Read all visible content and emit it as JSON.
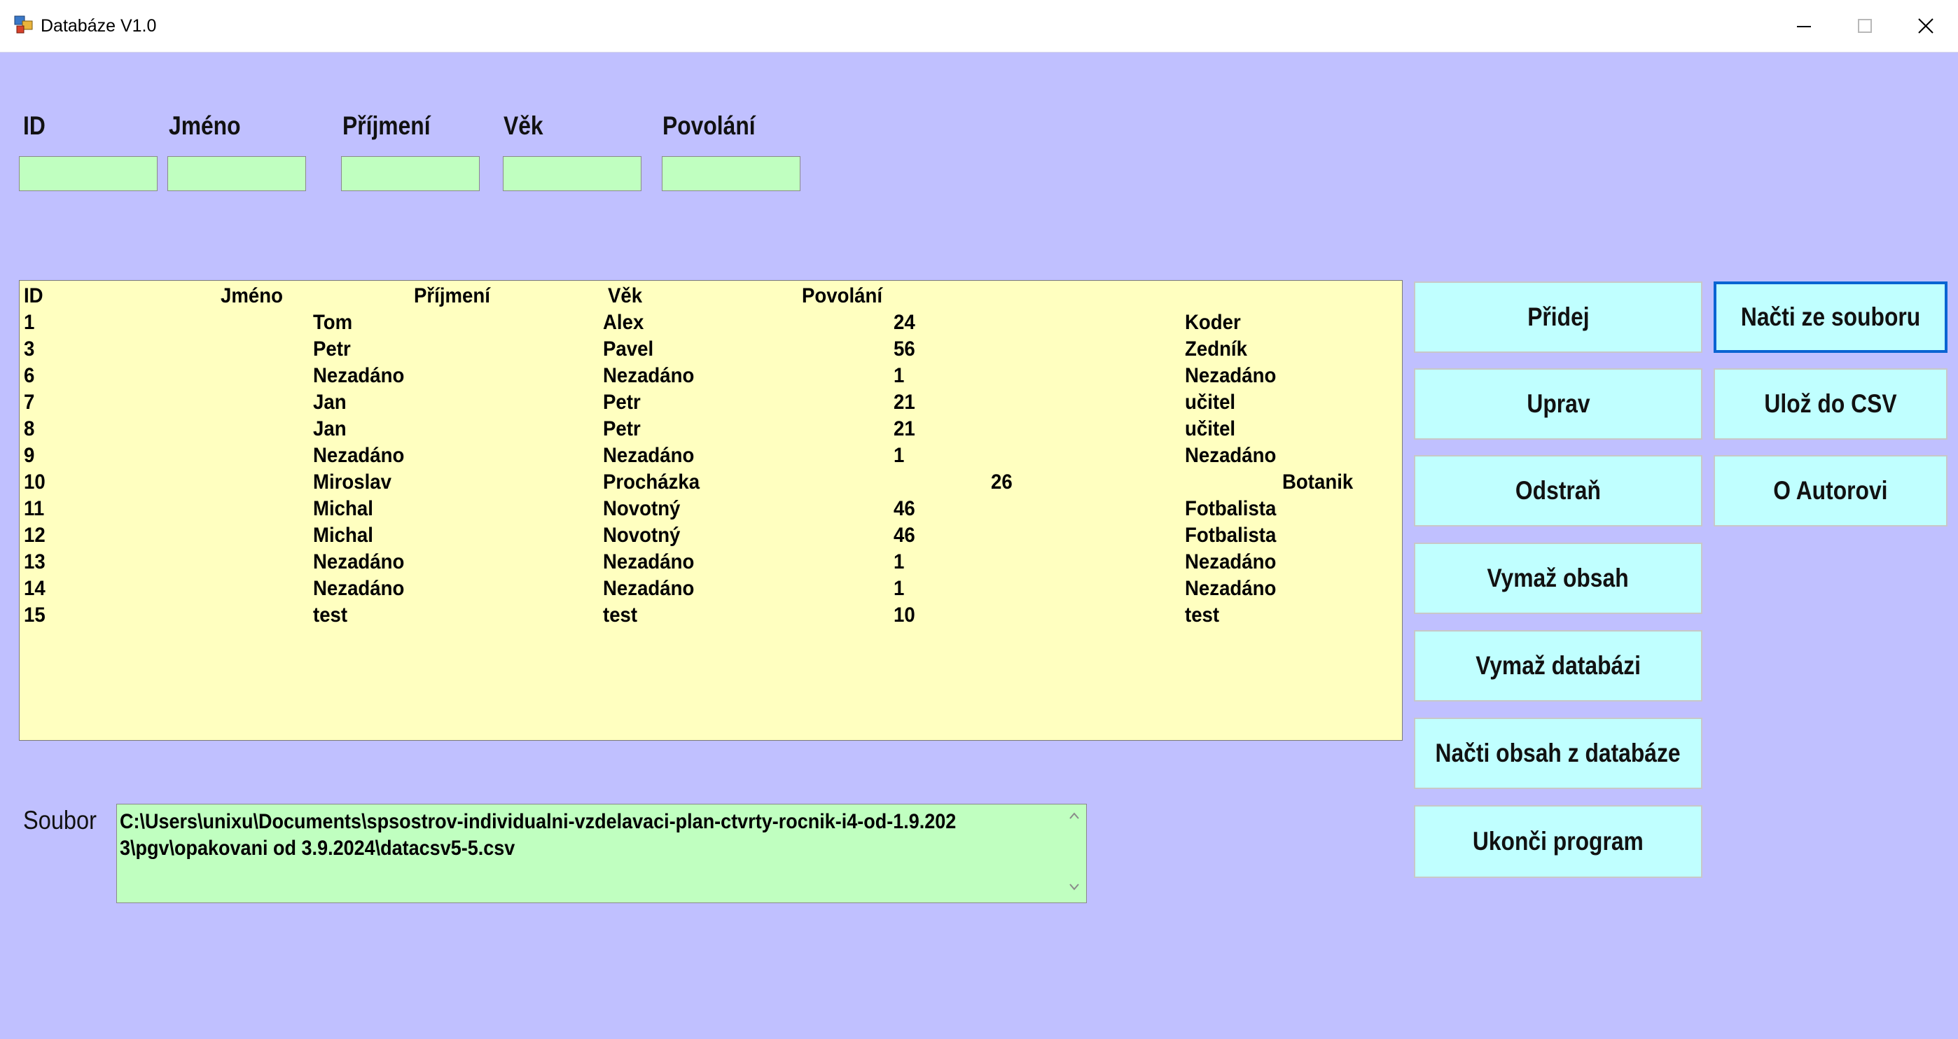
{
  "window": {
    "title": "Databáze V1.0"
  },
  "fields": [
    {
      "label": "ID",
      "value": ""
    },
    {
      "label": "Jméno",
      "value": ""
    },
    {
      "label": "Příjmení",
      "value": ""
    },
    {
      "label": "Věk",
      "value": ""
    },
    {
      "label": "Povolání",
      "value": ""
    }
  ],
  "list": {
    "header": [
      "ID",
      "Jméno",
      "Příjmení",
      "Věk",
      "Povolání"
    ],
    "rows": [
      [
        "1",
        "Tom",
        "Alex",
        "24",
        "Koder"
      ],
      [
        "3",
        "Petr",
        "Pavel",
        "56",
        "Zedník"
      ],
      [
        "6",
        "Nezadáno",
        "Nezadáno",
        "1",
        "Nezadáno"
      ],
      [
        "7",
        "Jan",
        "Petr",
        "21",
        "učitel"
      ],
      [
        "8",
        "Jan",
        "Petr",
        "21",
        "učitel"
      ],
      [
        "9",
        "Nezadáno",
        "Nezadáno",
        "1",
        "Nezadáno"
      ],
      [
        "10",
        "Miroslav",
        "Procházka",
        "26",
        "Botanik"
      ],
      [
        "11",
        "Michal",
        "Novotný",
        "46",
        "Fotbalista"
      ],
      [
        "12",
        "Michal",
        "Novotný",
        "46",
        "Fotbalista"
      ],
      [
        "13",
        "Nezadáno",
        "Nezadáno",
        "1",
        "Nezadáno"
      ],
      [
        "14",
        "Nezadáno",
        "Nezadáno",
        "1",
        "Nezadáno"
      ],
      [
        "15",
        "test",
        "test",
        "10",
        "test"
      ]
    ]
  },
  "buttons": {
    "pridej": "Přidej",
    "uprav": "Uprav",
    "odstran": "Odstraň",
    "vymaz_obsah": "Vymaž obsah",
    "vymaz_databazi": "Vymaž databázi",
    "nacti_obsah": "Načti obsah z databáze",
    "ukonci": "Ukonči program",
    "nacti_soubor": "Načti ze souboru",
    "uloz_csv": "Ulož do CSV",
    "o_autorovi": "O Autorovi"
  },
  "soubor": {
    "label": "Soubor",
    "path": "C:\\Users\\unixu\\Documents\\spsostrov-individualni-vzdelavaci-plan-ctvrty-rocnik-i4-od-1.9.2023\\pgv\\opakovani od 3.9.2024\\datacsv5-5.csv"
  }
}
